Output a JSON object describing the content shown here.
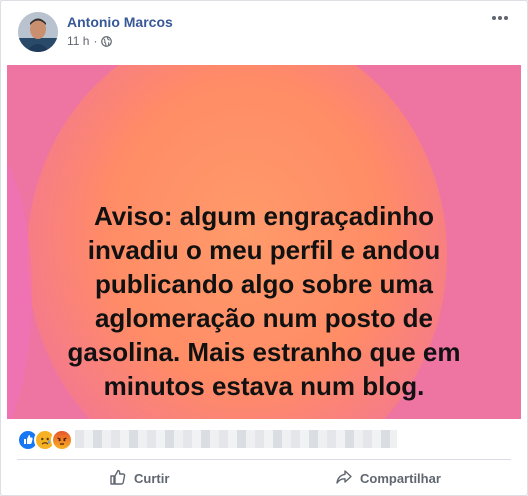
{
  "post": {
    "author": "Antonio Marcos",
    "time": "11 h",
    "separator": "·",
    "text": "Aviso: algum engraçadinho\ninvadiu o meu perfil e andou\npublicando algo sobre uma\naglomeração num posto de\ngasolina. Mais estranho que em\nminutos estava num blog.",
    "banner_color": "#ee75a2",
    "accent_color": "#ff8c66"
  },
  "reactions": {
    "icons": [
      "like-icon",
      "sad-icon",
      "angry-icon"
    ]
  },
  "actions": {
    "like_label": "Curtir",
    "share_label": "Compartilhar"
  }
}
